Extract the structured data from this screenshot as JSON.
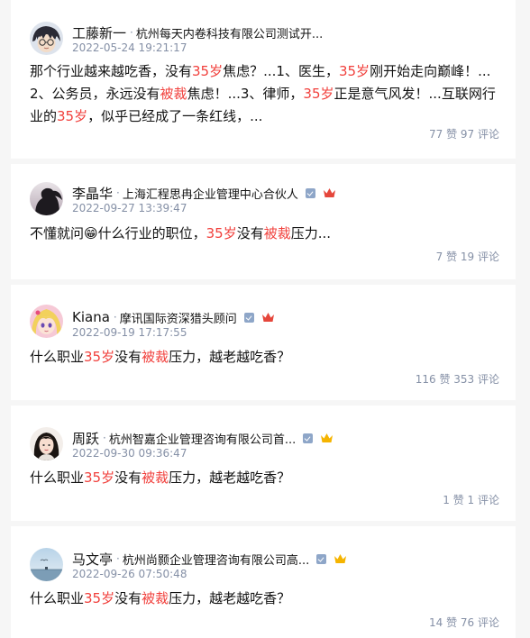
{
  "comments": [
    {
      "name": "工藤新一",
      "title": "杭州每天内卷科技有限公司测试开...",
      "date": "2022-05-24 19:21:17",
      "content_parts": [
        {
          "text": "那个行业越来越吃香，没有",
          "hl": false
        },
        {
          "text": "35岁",
          "hl": true
        },
        {
          "text": "焦虑？...1、医生，",
          "hl": false
        },
        {
          "text": "35岁",
          "hl": true
        },
        {
          "text": "刚开始走向巅峰！...2、公务员，永远没有",
          "hl": false
        },
        {
          "text": "被裁",
          "hl": true
        },
        {
          "text": "焦虑！...3、律师，",
          "hl": false
        },
        {
          "text": "35岁",
          "hl": true
        },
        {
          "text": "正是意气风发！...互联网行业的",
          "hl": false
        },
        {
          "text": "35岁",
          "hl": true
        },
        {
          "text": "，似乎已经成了一条红线，...",
          "hl": false
        }
      ],
      "stats": "77 赞 97 评论",
      "badges": [],
      "avatar_icon": "anime-boy-avatar"
    },
    {
      "name": "李晶华",
      "title": "上海汇程思冉企业管理中心合伙人",
      "date": "2022-09-27 13:39:47",
      "content_parts": [
        {
          "text": "不懂就问😁什么行业的职位，",
          "hl": false
        },
        {
          "text": "35岁",
          "hl": true
        },
        {
          "text": "没有",
          "hl": false
        },
        {
          "text": "被裁",
          "hl": true
        },
        {
          "text": "压力...",
          "hl": false
        }
      ],
      "stats": "7 赞 19 评论",
      "badges": [
        "verified-badge-icon",
        "red-crown-icon"
      ],
      "avatar_icon": "silhouette-avatar"
    },
    {
      "name": "Kiana",
      "title": "摩讯国际资深猎头顾问",
      "date": "2022-09-19 17:17:55",
      "content_parts": [
        {
          "text": "什么职业",
          "hl": false
        },
        {
          "text": "35岁",
          "hl": true
        },
        {
          "text": "没有",
          "hl": false
        },
        {
          "text": "被裁",
          "hl": true
        },
        {
          "text": "压力，越老越吃香？",
          "hl": false
        }
      ],
      "stats": "116 赞 353 评论",
      "badges": [
        "verified-badge-icon",
        "red-crown-icon"
      ],
      "avatar_icon": "anime-girl-avatar"
    },
    {
      "name": "周跃",
      "title": "杭州智嘉企业管理咨询有限公司首...",
      "date": "2022-09-30 09:36:47",
      "content_parts": [
        {
          "text": "什么职业",
          "hl": false
        },
        {
          "text": "35岁",
          "hl": true
        },
        {
          "text": "没有",
          "hl": false
        },
        {
          "text": "被裁",
          "hl": true
        },
        {
          "text": "压力，越老越吃香？",
          "hl": false
        }
      ],
      "stats": "1 赞 1 评论",
      "badges": [
        "verified-badge-icon",
        "gold-crown-icon"
      ],
      "avatar_icon": "woman-portrait-avatar"
    },
    {
      "name": "马文亭",
      "title": "杭州尚颢企业管理咨询有限公司高...",
      "date": "2022-09-26 07:50:48",
      "content_parts": [
        {
          "text": "什么职业",
          "hl": false
        },
        {
          "text": "35岁",
          "hl": true
        },
        {
          "text": "没有",
          "hl": false
        },
        {
          "text": "被裁",
          "hl": true
        },
        {
          "text": "压力，越老越吃香？",
          "hl": false
        }
      ],
      "stats": "14 赞 76 评论",
      "badges": [
        "verified-badge-icon",
        "gold-crown-icon"
      ],
      "avatar_icon": "seascape-avatar"
    }
  ],
  "colors": {
    "highlight": "#f1403c",
    "meta_gray": "#8590a6",
    "red_crown": "#e5463b",
    "gold_crown": "#f5b400",
    "verified_badge": "#8ea6c8"
  }
}
